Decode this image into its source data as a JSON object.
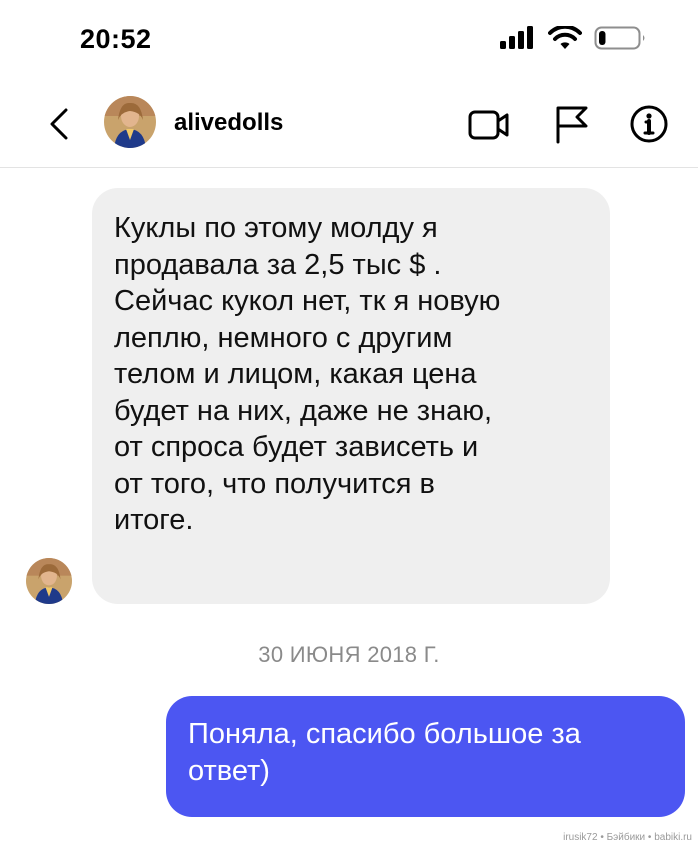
{
  "status_bar": {
    "time": "20:52",
    "icons": [
      "cellular-signal-icon",
      "wifi-icon",
      "battery-icon"
    ],
    "battery_level": 0.18
  },
  "header": {
    "username": "alivedolls",
    "actions": [
      "video-call-icon",
      "flag-icon",
      "info-icon"
    ]
  },
  "messages": [
    {
      "direction": "incoming",
      "text": "Куклы по этому молду  я\nпродавала за 2,5 тыс $ .\nСейчас кукол нет, тк я новую\nлеплю, немного с другим\nтелом и лицом, какая цена\nбудет на них, даже не знаю,\nот спроса будет зависеть и\nот того, что получится в\nитоге."
    },
    {
      "direction": "outgoing",
      "text": "Поняла, спасибо большое за\nответ)"
    }
  ],
  "date_separator": "30 ИЮНЯ 2018 Г.",
  "watermark": "irusik72 • Бэйбики • babiki.ru",
  "colors": {
    "outgoing_bubble": "#4c56f2",
    "incoming_bubble": "#efefef",
    "date_text": "#8a8a8a"
  }
}
